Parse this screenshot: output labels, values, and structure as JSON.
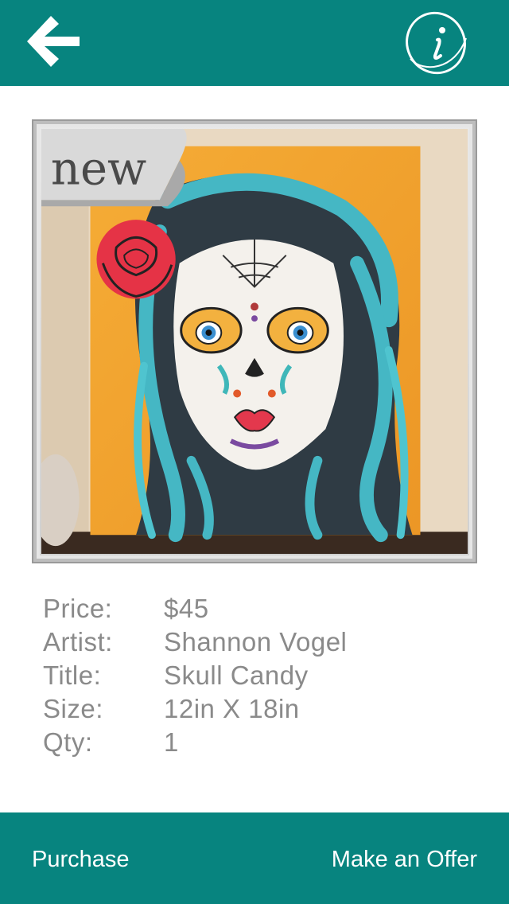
{
  "header": {
    "back_icon": "arrow-left-icon",
    "info_icon": "info-circle-icon"
  },
  "artwork": {
    "badge": "new",
    "description": "Painting of a sugar skull woman with teal and black flowing hair, red rose, on orange background"
  },
  "details": [
    {
      "label": "Price:",
      "value": "$45"
    },
    {
      "label": "Artist:",
      "value": "Shannon Vogel"
    },
    {
      "label": "Title:",
      "value": "Skull Candy"
    },
    {
      "label": "Size:",
      "value": "12in X 18in"
    },
    {
      "label": "Qty:",
      "value": "1"
    }
  ],
  "footer": {
    "purchase_label": "Purchase",
    "offer_label": "Make an Offer"
  },
  "colors": {
    "brand": "#07847f",
    "text_muted": "#8a8a8a"
  }
}
